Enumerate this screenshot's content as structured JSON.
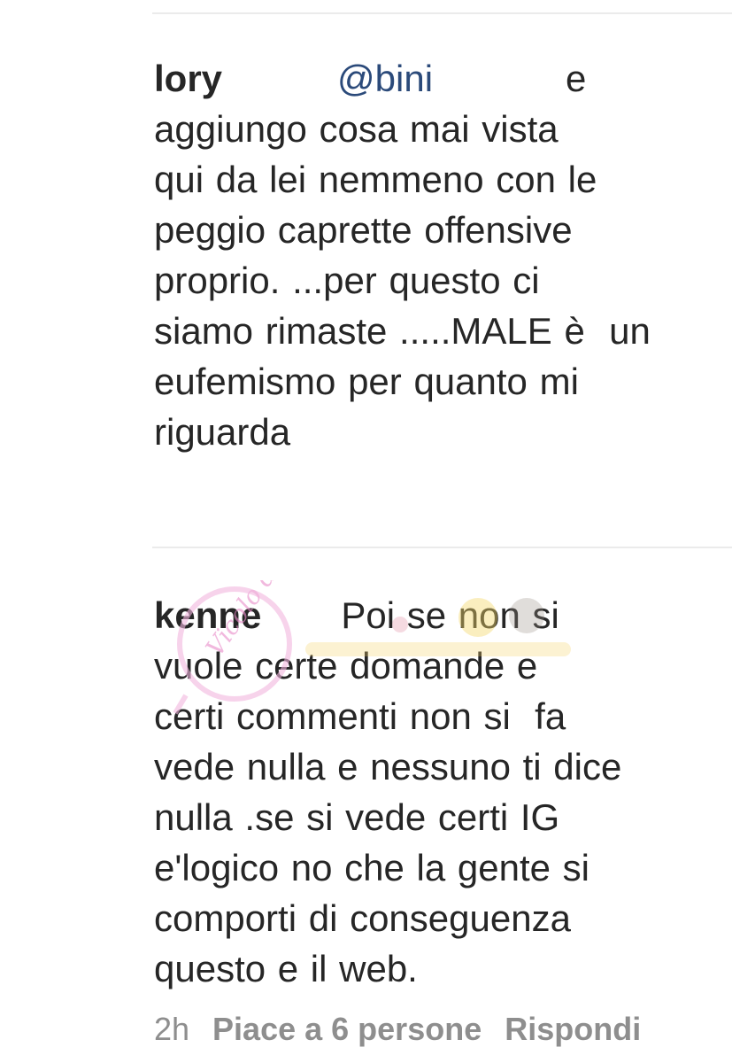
{
  "comments": [
    {
      "username": "lory",
      "mention": "@bini",
      "first_line_tail": "e",
      "lines": [
        "aggiungo cosa mai vista",
        "qui da lei nemmeno con le",
        "peggio caprette offensive",
        "proprio. ...per questo ci",
        "siamo rimaste .....MALE è  un",
        "eufemismo per quanto mi",
        "riguarda"
      ]
    },
    {
      "username": "kenne",
      "first_line_tail": "Poi se non si",
      "lines": [
        "vuole certe domande e",
        "certi commenti non si  fa",
        "vede nulla e nessuno ti dice",
        "nulla .se si vede certi IG",
        "e'logico no che la gente si",
        "comporti di conseguenza",
        "questo e il web."
      ],
      "meta": {
        "time": "2h",
        "likes": "Piace a 6 persone",
        "reply": "Rispondi"
      }
    }
  ],
  "watermark": {
    "text": "Vicolo delle News"
  },
  "colors": {
    "text": "#262626",
    "mention": "#2b4a7a",
    "meta": "#8e8e8e",
    "divider": "#ebebeb"
  }
}
